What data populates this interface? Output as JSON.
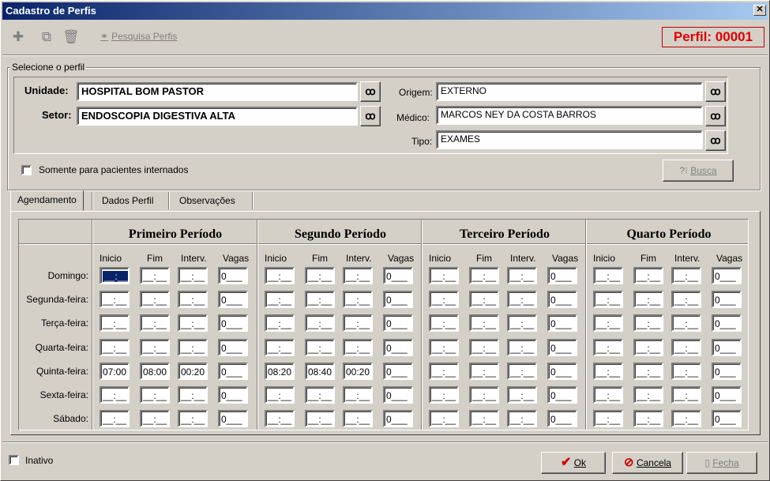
{
  "window": {
    "title": "Cadastro de Perfis",
    "close_glyph": "✕"
  },
  "toolbar": {
    "add_icon": "plus-icon",
    "copy_icon": "copy-icon",
    "delete_icon": "trash-icon",
    "search_label": "Pesquisa Perfis",
    "perfil_label": "Perfil: 00001"
  },
  "selection": {
    "legend": "Selecione o perfil",
    "unidade_label": "Unidade:",
    "unidade_value": "HOSPITAL BOM PASTOR",
    "setor_label": "Setor:",
    "setor_value": "ENDOSCOPIA DIGESTIVA ALTA",
    "origem_label": "Origem:",
    "origem_value": "EXTERNO",
    "medico_label": "Médico:",
    "medico_value": "MARCOS NEY DA COSTA BARROS",
    "tipo_label": "Tipo:",
    "tipo_value": "EXAMES",
    "internados_label": "Somente para pacientes internados",
    "internados_checked": false,
    "busca_label": "Busca"
  },
  "tabs": [
    {
      "label": "Agendamento",
      "active": true
    },
    {
      "label": "Dados Perfil",
      "active": false
    },
    {
      "label": "Observações",
      "active": false
    }
  ],
  "schedule": {
    "periods": [
      "Primeiro Período",
      "Segundo Período",
      "Terceiro Período",
      "Quarto Período"
    ],
    "columns": [
      "Inicio",
      "Fim",
      "Interv.",
      "Vagas"
    ],
    "days": [
      "Domingo:",
      "Segunda-feira:",
      "Terça-feira:",
      "Quarta-feira:",
      "Quinta-feira:",
      "Sexta-feira:",
      "Sábado:"
    ],
    "empty_time": "__:__",
    "empty_vagas": "0___",
    "filled": {
      "4": {
        "0": [
          "07:00",
          "08:00",
          "00:20",
          "0___"
        ],
        "1": [
          "08:20",
          "08:40",
          "00:20",
          "0___"
        ]
      }
    }
  },
  "footer": {
    "inativo_label": "Inativo",
    "ok_label": "Ok",
    "cancel_label": "Cancela",
    "close_label": "Fecha"
  },
  "colors": {
    "perfil": "#e00000",
    "ok_check": "#cc0000",
    "cancel_icon": "#cc0000",
    "titlebar": "#0a246a"
  }
}
